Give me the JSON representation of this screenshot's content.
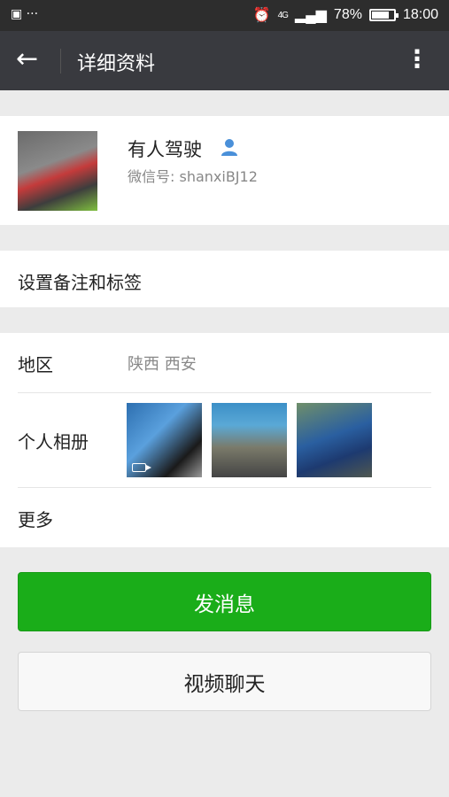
{
  "status_bar": {
    "notify_icons": "▣ ···",
    "network": "4G",
    "battery": "78%",
    "battery_level": 0.78,
    "time": "18:00"
  },
  "title_bar": {
    "title": "详细资料"
  },
  "profile": {
    "name": "有人驾驶",
    "wechat_id": "微信号: shanxiBJ12"
  },
  "remark": {
    "label": "设置备注和标签"
  },
  "info": {
    "region_label": "地区",
    "region_value": "陕西  西安",
    "album_label": "个人相册",
    "more_label": "更多"
  },
  "actions": {
    "send_label": "发消息",
    "video_label": "视频聊天"
  },
  "colors": {
    "accent": "#1aad19",
    "titlebar": "#393a3f"
  }
}
